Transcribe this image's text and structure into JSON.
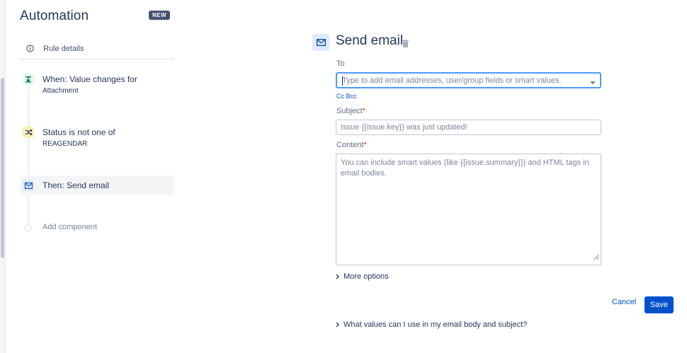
{
  "sidebar": {
    "title": "Automation",
    "badge": "NEW",
    "rule_details": "Rule details",
    "steps": [
      {
        "title": "When: Value changes for",
        "subtitle": "Attachment",
        "icon": "trigger-icon"
      },
      {
        "title": "Status is not one of",
        "subtitle": "REAGENDAR",
        "icon": "condition-icon"
      },
      {
        "title": "Then: Send email",
        "icon": "email-icon"
      }
    ],
    "add_component": "Add component"
  },
  "panel": {
    "title": "Send email",
    "to_label": "To",
    "to_placeholder": "Type to add email addresses, user/group fields or smart values.",
    "cc_bcc": "Cc Bcc",
    "subject_label": "Subject",
    "subject_placeholder": "Issue {{issue.key}} was just updated!",
    "content_label": "Content",
    "content_placeholder": "You can include smart values (like {{issue.summary}}) and HTML tags in email bodies.",
    "more_options": "More options",
    "cancel": "Cancel",
    "save": "Save",
    "help": "What values can I use in my email body and subject?"
  },
  "colors": {
    "accent": "#0052cc",
    "required": "#de350b",
    "focus": "#4c9aff"
  }
}
